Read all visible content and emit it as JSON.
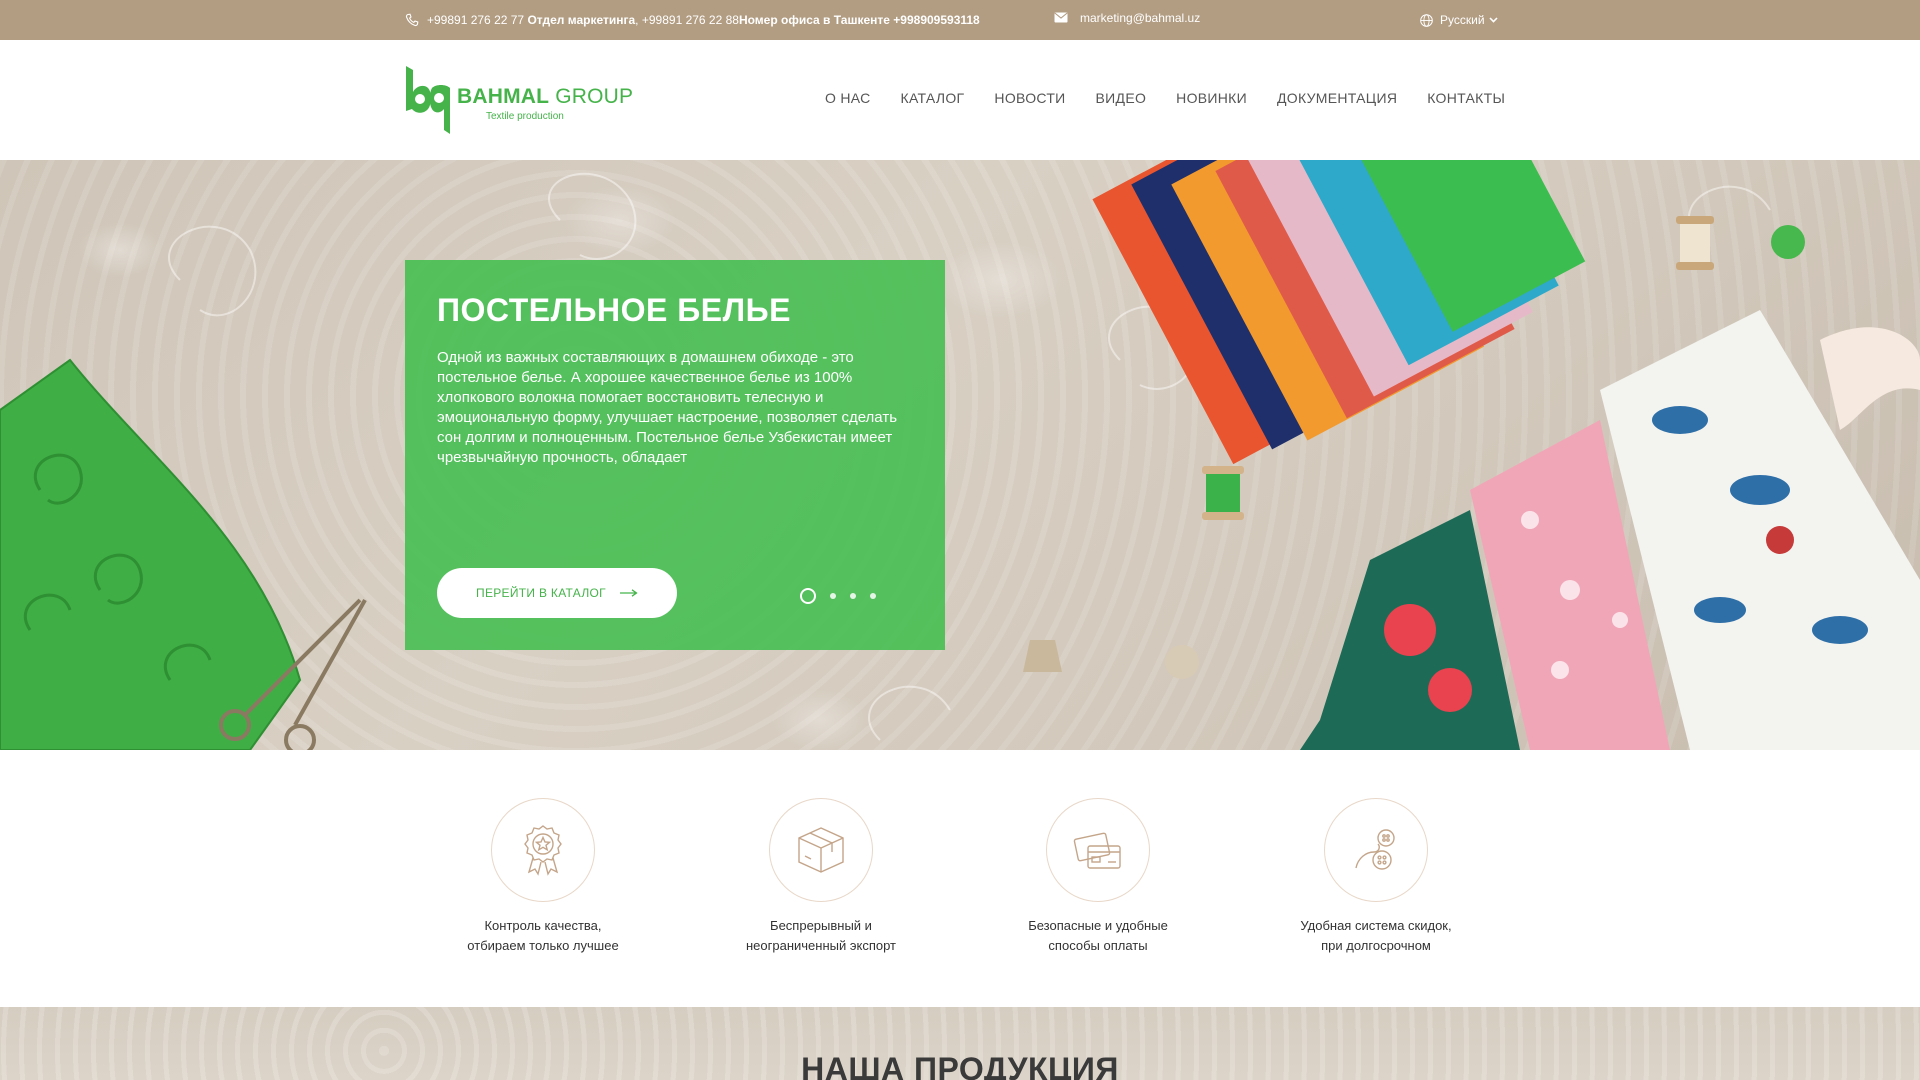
{
  "topbar": {
    "phone_1": "+99891 276 22 77",
    "phone_1_label": "Отдел маркетинга",
    "phone_sep": ",",
    "phone_2": "+99891 276 22 88",
    "phone_2_label": "Номер офиса в Ташкенте",
    "phone_3": "+998909593118",
    "email": "marketing@bahmal.uz",
    "language": "Русский"
  },
  "logo": {
    "brand_bold": "BAHMAL",
    "brand_light": "GROUP",
    "tagline": "Textile production"
  },
  "nav": {
    "items": [
      {
        "label": "О НАС"
      },
      {
        "label": "КАТАЛОГ"
      },
      {
        "label": "НОВОСТИ"
      },
      {
        "label": "ВИДЕО"
      },
      {
        "label": "НОВИНКИ"
      },
      {
        "label": "ДОКУМЕНТАЦИЯ"
      },
      {
        "label": "КОНТАКТЫ"
      }
    ]
  },
  "hero": {
    "title": "ПОСТЕЛЬНОЕ БЕЛЬЕ",
    "text": "Одной из важных составляющих в домашнем обиходе - это постельное белье. А хорошее качественное белье из 100% хлопкового волокна помогает восстановить телесную и эмоциональную форму, улучшает настроение, позволяет сделать сон долгим и полноценным. Постельное белье Узбекистан имеет чрезвычайную прочность, обладает",
    "cta_label": "ПЕРЕЙТИ В КАТАЛОГ",
    "slide_count": 4,
    "active_slide": 1,
    "accent_color": "#45b34a"
  },
  "features": {
    "items": [
      {
        "line1": "Контроль качества,",
        "line2": "отбираем только лучшее",
        "icon": "quality-badge-icon"
      },
      {
        "line1": "Беспрерывный и",
        "line2": "неограниченный экспорт",
        "icon": "box-icon"
      },
      {
        "line1": "Безопасные и удобные",
        "line2": "способы оплаты",
        "icon": "payment-cards-icon"
      },
      {
        "line1": "Удобная система скидок,",
        "line2": "при долгосрочном",
        "icon": "buttons-thread-icon"
      }
    ]
  },
  "products": {
    "title": "НАША ПРОДУКЦИЯ"
  }
}
